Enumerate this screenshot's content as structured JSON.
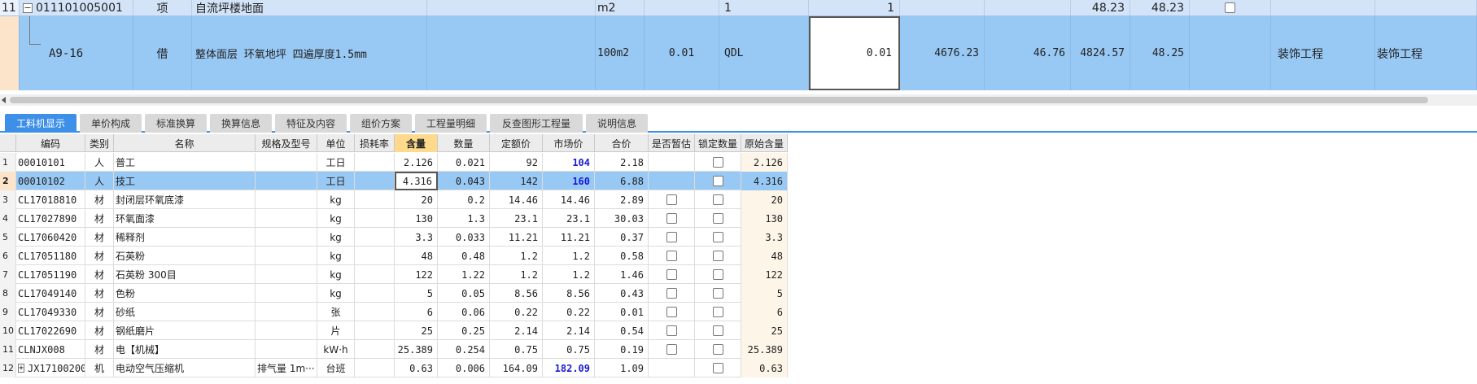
{
  "top_grid": {
    "row11": {
      "rownum": "11",
      "expander": "−",
      "code": "011101005001",
      "type": "项",
      "name": "自流坪楼地面",
      "unit": "m2",
      "qty_expr": "1",
      "qty": "1",
      "col_a": "48.23",
      "col_b": "48.23"
    },
    "rowA916": {
      "code": "A9-16",
      "type": "借",
      "name": "整体面层 环氧地坪 四遍厚度1.5mm",
      "unit": "100m2",
      "ratio": "0.01",
      "qty_expr": "QDL",
      "qty": "0.01",
      "unit_price": "4676.23",
      "total": "46.76",
      "price2": "4824.57",
      "total2": "48.25",
      "category1": "装饰工程",
      "category2": "装饰工程"
    }
  },
  "tabs": [
    {
      "label": "工料机显示",
      "active": true
    },
    {
      "label": "单价构成",
      "active": false
    },
    {
      "label": "标准换算",
      "active": false
    },
    {
      "label": "换算信息",
      "active": false
    },
    {
      "label": "特征及内容",
      "active": false
    },
    {
      "label": "组价方案",
      "active": false
    },
    {
      "label": "工程量明细",
      "active": false
    },
    {
      "label": "反查图形工程量",
      "active": false
    },
    {
      "label": "说明信息",
      "active": false
    }
  ],
  "table": {
    "columns": [
      "",
      "编码",
      "类别",
      "名称",
      "规格及型号",
      "单位",
      "损耗率",
      "含量",
      "数量",
      "定额价",
      "市场价",
      "合价",
      "是否暂估",
      "锁定数量",
      "原始含量"
    ],
    "rows": [
      {
        "n": "1",
        "code": "00010101",
        "cat": "人",
        "name": "普工",
        "spec": "",
        "unit": "工日",
        "loss": "",
        "content": "2.126",
        "qty": "0.021",
        "quota": "92",
        "market": "104",
        "total": "2.18",
        "est": false,
        "lock": true,
        "orig": "2.126",
        "market_hl": true
      },
      {
        "n": "2",
        "code": "00010102",
        "cat": "人",
        "name": "技工",
        "spec": "",
        "unit": "工日",
        "loss": "",
        "content": "4.316",
        "qty": "0.043",
        "quota": "142",
        "market": "160",
        "total": "6.88",
        "est": false,
        "lock": true,
        "orig": "4.316",
        "market_hl": true
      },
      {
        "n": "3",
        "code": "CL17018810",
        "cat": "材",
        "name": "封闭层环氧底漆",
        "spec": "",
        "unit": "kg",
        "loss": "",
        "content": "20",
        "qty": "0.2",
        "quota": "14.46",
        "market": "14.46",
        "total": "2.89",
        "est": true,
        "lock": true,
        "orig": "20"
      },
      {
        "n": "4",
        "code": "CL17027890",
        "cat": "材",
        "name": "环氧面漆",
        "spec": "",
        "unit": "kg",
        "loss": "",
        "content": "130",
        "qty": "1.3",
        "quota": "23.1",
        "market": "23.1",
        "total": "30.03",
        "est": true,
        "lock": true,
        "orig": "130"
      },
      {
        "n": "5",
        "code": "CL17060420",
        "cat": "材",
        "name": "稀释剂",
        "spec": "",
        "unit": "kg",
        "loss": "",
        "content": "3.3",
        "qty": "0.033",
        "quota": "11.21",
        "market": "11.21",
        "total": "0.37",
        "est": true,
        "lock": true,
        "orig": "3.3"
      },
      {
        "n": "6",
        "code": "CL17051180",
        "cat": "材",
        "name": "石英粉",
        "spec": "",
        "unit": "kg",
        "loss": "",
        "content": "48",
        "qty": "0.48",
        "quota": "1.2",
        "market": "1.2",
        "total": "0.58",
        "est": true,
        "lock": true,
        "orig": "48"
      },
      {
        "n": "7",
        "code": "CL17051190",
        "cat": "材",
        "name": "石英粉 300目",
        "spec": "",
        "unit": "kg",
        "loss": "",
        "content": "122",
        "qty": "1.22",
        "quota": "1.2",
        "market": "1.2",
        "total": "1.46",
        "est": true,
        "lock": true,
        "orig": "122"
      },
      {
        "n": "8",
        "code": "CL17049140",
        "cat": "材",
        "name": "色粉",
        "spec": "",
        "unit": "kg",
        "loss": "",
        "content": "5",
        "qty": "0.05",
        "quota": "8.56",
        "market": "8.56",
        "total": "0.43",
        "est": true,
        "lock": true,
        "orig": "5"
      },
      {
        "n": "9",
        "code": "CL17049330",
        "cat": "材",
        "name": "砂纸",
        "spec": "",
        "unit": "张",
        "loss": "",
        "content": "6",
        "qty": "0.06",
        "quota": "0.22",
        "market": "0.22",
        "total": "0.01",
        "est": true,
        "lock": true,
        "orig": "6"
      },
      {
        "n": "10",
        "code": "CL17022690",
        "cat": "材",
        "name": "钢纸磨片",
        "spec": "",
        "unit": "片",
        "loss": "",
        "content": "25",
        "qty": "0.25",
        "quota": "2.14",
        "market": "2.14",
        "total": "0.54",
        "est": true,
        "lock": true,
        "orig": "25"
      },
      {
        "n": "11",
        "code": "CLNJX008",
        "cat": "材",
        "name": "电【机械】",
        "spec": "",
        "unit": "kW·h",
        "loss": "",
        "content": "25.389",
        "qty": "0.254",
        "quota": "0.75",
        "market": "0.75",
        "total": "0.19",
        "est": true,
        "lock": true,
        "orig": "25.389"
      },
      {
        "n": "12",
        "code": "JX17100200",
        "cat": "机",
        "name": "电动空气压缩机",
        "spec": "排气量 1m···",
        "unit": "台班",
        "loss": "",
        "content": "0.63",
        "qty": "0.006",
        "quota": "164.09",
        "market": "182.09",
        "total": "1.09",
        "est": false,
        "lock": true,
        "orig": "0.63",
        "market_hl": true,
        "expandable": true,
        "expander": "+"
      }
    ]
  },
  "colors": {
    "selected_row": "#98c8f4",
    "tab_active": "#3d8fe8",
    "highlight_price": "#1a1ad6"
  }
}
